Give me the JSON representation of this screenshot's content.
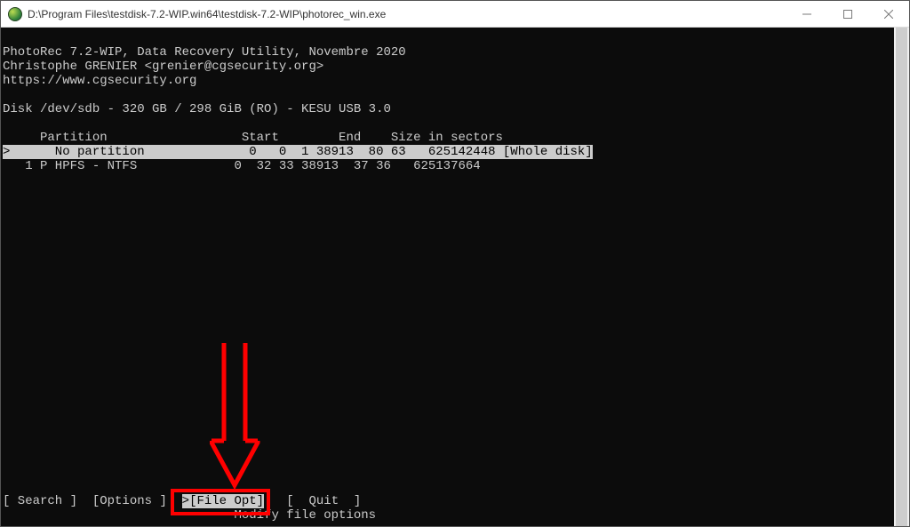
{
  "window": {
    "title": "D:\\Program Files\\testdisk-7.2-WIP.win64\\testdisk-7.2-WIP\\photorec_win.exe"
  },
  "header": {
    "line1": "PhotoRec 7.2-WIP, Data Recovery Utility, Novembre 2020",
    "line2": "Christophe GRENIER <grenier@cgsecurity.org>",
    "line3": "https://www.cgsecurity.org"
  },
  "disk_info": "Disk /dev/sdb - 320 GB / 298 GiB (RO) - KESU USB 3.0",
  "table": {
    "columns": "     Partition                  Start        End    Size in sectors",
    "rows": [
      {
        "selected": true,
        "text": ">      No partition              0   0  1 38913  80 63   625142448 [Whole disk]"
      },
      {
        "selected": false,
        "text": "   1 P HPFS - NTFS             0  32 33 38913  37 36   625137664"
      }
    ]
  },
  "menu": {
    "search": "[ Search ]",
    "options": "[Options ]",
    "file_opt_prefix": ">",
    "file_opt": "[File Opt]",
    "quit": "[  Quit  ]"
  },
  "status": "                               Modify file options"
}
